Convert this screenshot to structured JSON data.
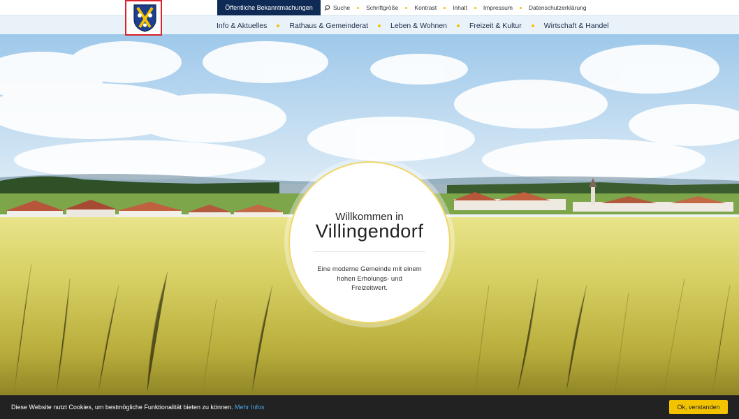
{
  "topbar": {
    "notice_button": "Öffentliche Bekanntmachungen",
    "utility": {
      "search": "Suche",
      "fontsize": "Schriftgröße",
      "contrast": "Kontrast",
      "content": "Inhalt",
      "imprint": "Impressum",
      "privacy": "Datenschutzerklärung"
    }
  },
  "nav": {
    "info": "Info & Aktuelles",
    "rathaus": "Rathaus & Gemeinderat",
    "leben": "Leben & Wohnen",
    "freizeit": "Freizeit & Kultur",
    "wirtschaft": "Wirtschaft & Handel"
  },
  "hero": {
    "welcome": "Willkommen in",
    "town": "Villingendorf",
    "tagline_1": "Eine moderne Gemeinde mit einem",
    "tagline_2": "hohen Erholungs- und",
    "tagline_3": "Freizeitwert."
  },
  "cookie": {
    "message": "Diese Website nutzt Cookies, um bestmögliche Funktionalität bieten zu können. ",
    "more": "Mehr Infos",
    "accept": "Ok, verstanden"
  },
  "colors": {
    "navy": "#0f2b55",
    "accent_yellow": "#f2c200",
    "nav_bg": "#e9f2f9",
    "cookie_bg": "#222222"
  },
  "icons": [
    "coat-of-arms-logo",
    "search-icon"
  ]
}
